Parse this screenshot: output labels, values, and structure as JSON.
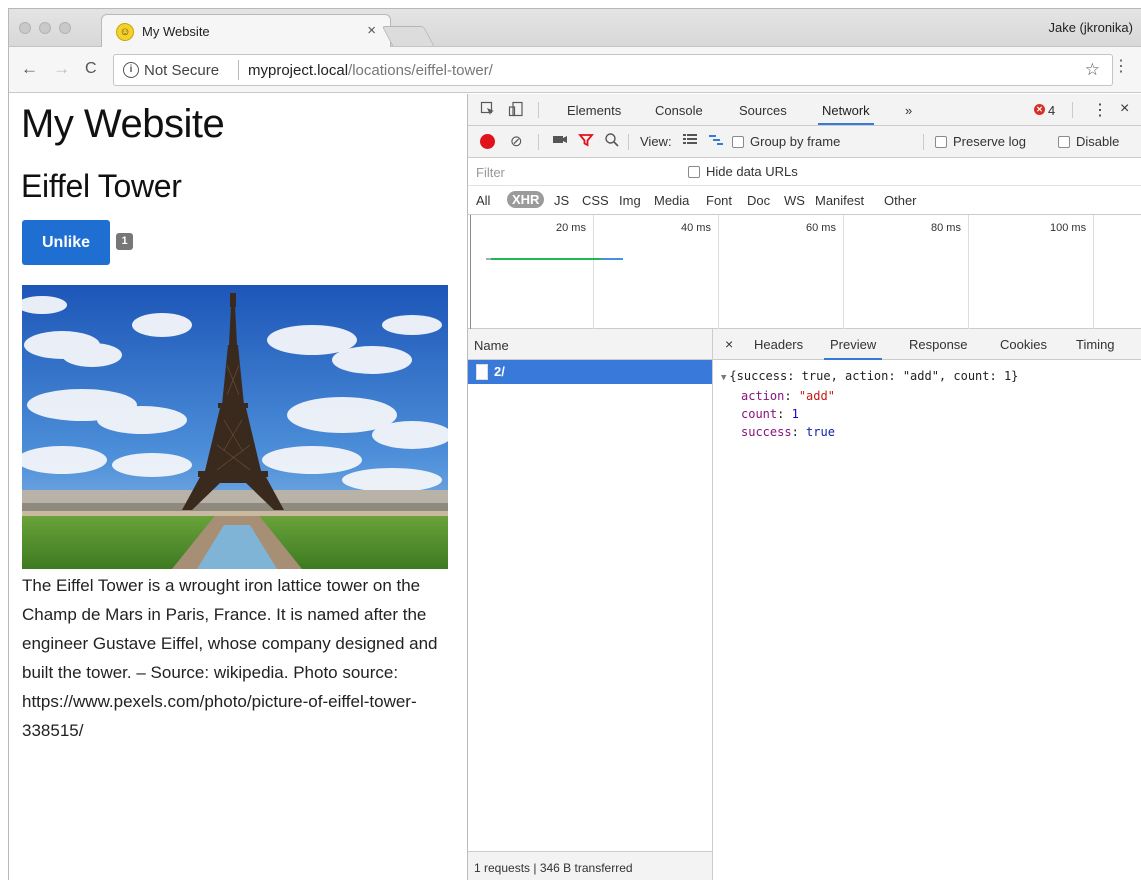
{
  "browser": {
    "tab_title": "My Website",
    "tab_close": "×",
    "profile_name": "Jake (jkronika)",
    "nav": {
      "back": "←",
      "forward": "→",
      "reload": "C"
    },
    "security_label": "Not Secure",
    "url_host": "myproject.local",
    "url_path": "/locations/eiffel-tower/",
    "star": "☆",
    "menu": "⋮"
  },
  "page": {
    "site_title": "My Website",
    "location_title": "Eiffel Tower",
    "unlike_label": "Unlike",
    "like_count": "1",
    "description": "The Eiffel Tower is a wrought iron lattice tower on the Champ de Mars in Paris, France. It is named after the engineer Gustave Eiffel, whose company designed and built the tower. – Source: wikipedia. Photo source: https://www.pexels.com/photo/picture-of-eiffel-tower-338515/"
  },
  "devtools": {
    "tabs": [
      "Elements",
      "Console",
      "Sources",
      "Network"
    ],
    "more_tabs": "»",
    "active_tab": "Network",
    "error_count": "4",
    "close": "×",
    "toolbar": {
      "view_label": "View:",
      "group_by_frame": "Group by frame",
      "preserve_log": "Preserve log",
      "disable_cache": "Disable"
    },
    "filter_placeholder": "Filter",
    "hide_data_urls": "Hide data URLs",
    "types": [
      "All",
      "XHR",
      "JS",
      "CSS",
      "Img",
      "Media",
      "Font",
      "Doc",
      "WS",
      "Manifest",
      "Other"
    ],
    "selected_type": "XHR",
    "timeline_ticks": [
      "20 ms",
      "40 ms",
      "60 ms",
      "80 ms",
      "100 ms"
    ],
    "name_header": "Name",
    "request_name": "2/",
    "status": "1 requests | 346 B transferred",
    "detail_close": "×",
    "detail_tabs": [
      "Headers",
      "Preview",
      "Response",
      "Cookies",
      "Timing"
    ],
    "active_detail_tab": "Preview",
    "preview": {
      "summary": "{success: true, action: \"add\", count: 1}",
      "action_key": "action",
      "action_value": "\"add\"",
      "count_key": "count",
      "count_value": "1",
      "success_key": "success",
      "success_value": "true"
    }
  },
  "colors": {
    "accent_blue": "#3879d9",
    "button_blue": "#1f6fd3",
    "record_red": "#e0131c",
    "timeline_green": "#1db954",
    "timeline_blue": "#4a90e2"
  }
}
